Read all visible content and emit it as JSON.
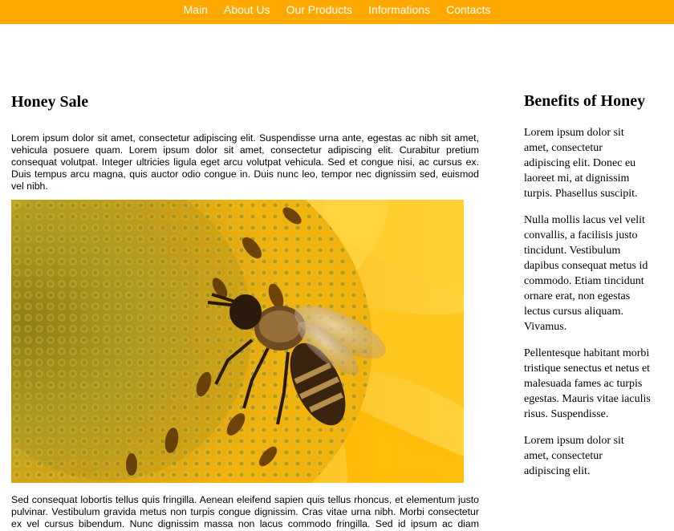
{
  "nav": {
    "items": [
      {
        "label": "Main"
      },
      {
        "label": "About Us"
      },
      {
        "label": "Our Products"
      },
      {
        "label": "Informations"
      },
      {
        "label": "Contacts"
      }
    ]
  },
  "main": {
    "title": "Honey Sale",
    "intro": "Lorem ipsum dolor sit amet, consectetur adipiscing elit. Suspendisse urna ante, egestas ac nibh sit amet, vehicula posuere quam. Lorem ipsum dolor sit amet, consectetur adipiscing elit. Curabitur pretium consequat volutpat. Integer ultricies ligula eget arcu volutpat vehicula. Sed et congue nisi, ac cursus ex. Duis tempus arcu magna, quis auctor odio congue in. Duis nunc leo, tempor nec dignissim sed, euismod vel nibh.",
    "body": "Sed consequat lobortis tellus quis fringilla. Aenean eleifend sapien quis tellus rhoncus, et elementum justo pulvinar. Vestibulum gravida metus non turpis congue dignissim. Cras vitae urna nibh. Morbi consectetur ex vel cursus bibendum. Nunc dignissim massa non lacus commodo fringilla. Sed id ipsum ac diam fermentum condimentum feugiat a nunc. Nulla facilisi. Donec ut eros id erat blandit interdum."
  },
  "sidebar": {
    "title": "Benefits of Honey",
    "paragraphs": [
      "Lorem ipsum dolor sit amet, consectetur adipiscing elit. Donec eu laoreet mi, at dignissim turpis. Phasellus suscipit.",
      "Nulla mollis lacus vel velit convallis, a facilisis justo tincidunt. Vestibulum dapibus consequat metus id commodo. Etiam tincidunt ornare erat, non egestas lectus cursus aliquam. Vivamus.",
      "Pellentesque habitant morbi tristique senectus et netus et malesuada fames ac turpis egestas. Mauris vitae iaculis risus. Suspendisse.",
      "Lorem ipsum dolor sit amet, consectetur adipiscing elit."
    ]
  },
  "colors": {
    "nav_bg": "#ffa800",
    "nav_text": "#ffffff",
    "text": "#000000"
  }
}
